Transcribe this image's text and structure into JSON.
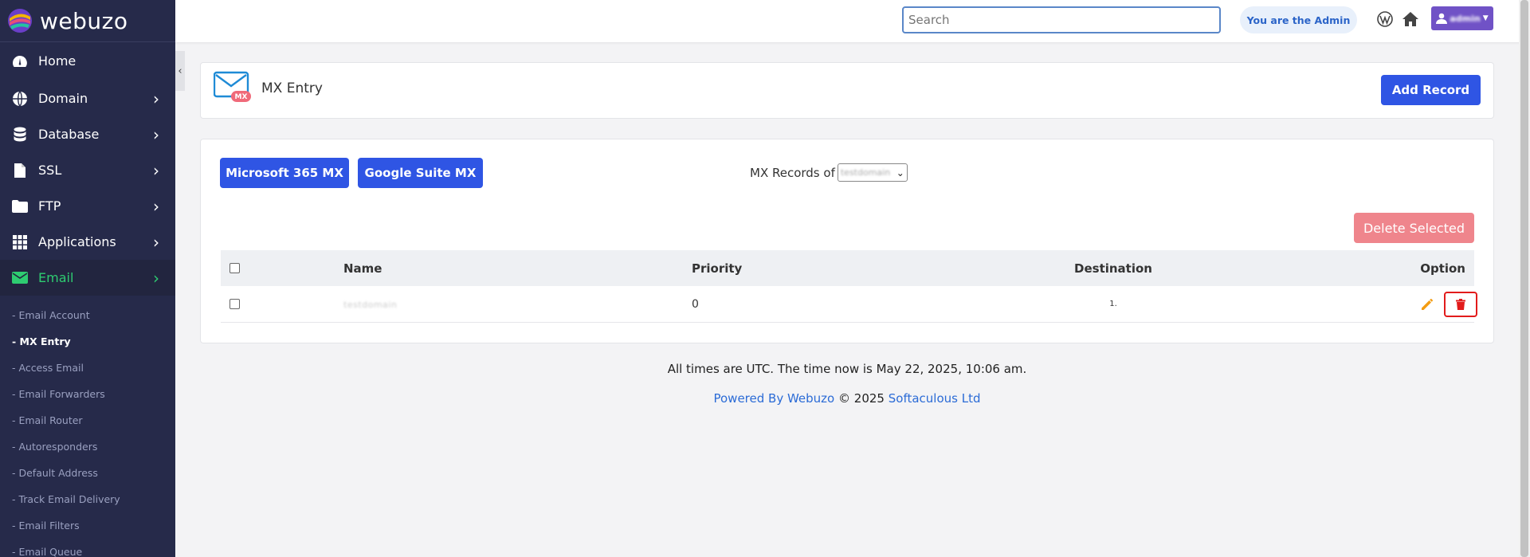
{
  "app": {
    "logo_text": "webuzo"
  },
  "sidebar": {
    "items": [
      {
        "label": "Home",
        "icon": "dashboard-icon"
      },
      {
        "label": "Domain",
        "icon": "globe-icon"
      },
      {
        "label": "Database",
        "icon": "database-icon"
      },
      {
        "label": "SSL",
        "icon": "file-icon"
      },
      {
        "label": "FTP",
        "icon": "folder-icon"
      },
      {
        "label": "Applications",
        "icon": "grid-icon"
      },
      {
        "label": "Email",
        "icon": "envelope-icon"
      }
    ],
    "submenu": [
      "- Email Account",
      "- MX Entry",
      "- Access Email",
      "- Email Forwarders",
      "- Email Router",
      "- Autoresponders",
      "- Default Address",
      "- Track Email Delivery",
      "- Email Filters",
      "- Email Queue"
    ],
    "collapse_glyph": "‹"
  },
  "topbar": {
    "search_placeholder": "Search",
    "admin_label": "You are the Admin",
    "user_name": "admin"
  },
  "page": {
    "title": "MX Entry",
    "icon_badge": "MX",
    "add_record_label": "Add Record",
    "ms365_label": "Microsoft 365 MX",
    "gsuite_label": "Google Suite MX",
    "mx_records_label": "MX Records of",
    "domain_select_value": "testdomain",
    "delete_selected_label": "Delete Selected"
  },
  "table": {
    "headers": {
      "name": "Name",
      "priority": "Priority",
      "destination": "Destination",
      "option": "Option"
    },
    "rows": [
      {
        "name": "testdomain",
        "priority": "0",
        "destination": "1."
      }
    ]
  },
  "footer": {
    "time_text": "All times are UTC. The time now is May 22, 2025, 10:06 am.",
    "powered_by": "Powered By Webuzo",
    "copyright": "© 2025",
    "company": "Softaculous Ltd"
  },
  "colors": {
    "sidebar_bg": "#262a4a",
    "primary": "#2f55e4",
    "active_green": "#2ecc71",
    "danger": "#e21b1b",
    "user_purple": "#7052c6"
  }
}
